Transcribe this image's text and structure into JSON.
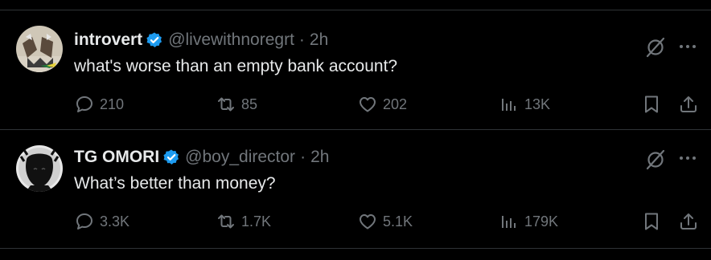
{
  "colors": {
    "background": "#000000",
    "text": "#e7e9ea",
    "muted": "#71767b",
    "verified": "#1d9bf0",
    "divider": "#2f3336"
  },
  "icons": {
    "reply": "speech-bubble-icon",
    "retweet": "repost-arrows-icon",
    "like": "heart-icon",
    "views": "bar-chart-icon",
    "bookmark": "bookmark-icon",
    "share": "share-upload-icon",
    "grok": "grok-slash-circle-icon",
    "more": "ellipsis-icon",
    "verified": "blue-check-badge-icon"
  },
  "tweets": [
    {
      "name": "introvert",
      "handle": "@livewithnoregrt",
      "dot": "·",
      "time": "2h",
      "text": "what's worse than an empty bank account?",
      "replies": "210",
      "reposts": "85",
      "likes": "202",
      "views": "13K"
    },
    {
      "name": "TG OMORI",
      "handle": "@boy_director",
      "dot": "·",
      "time": "2h",
      "text": "What’s better than money?",
      "replies": "3.3K",
      "reposts": "1.7K",
      "likes": "5.1K",
      "views": "179K"
    }
  ]
}
